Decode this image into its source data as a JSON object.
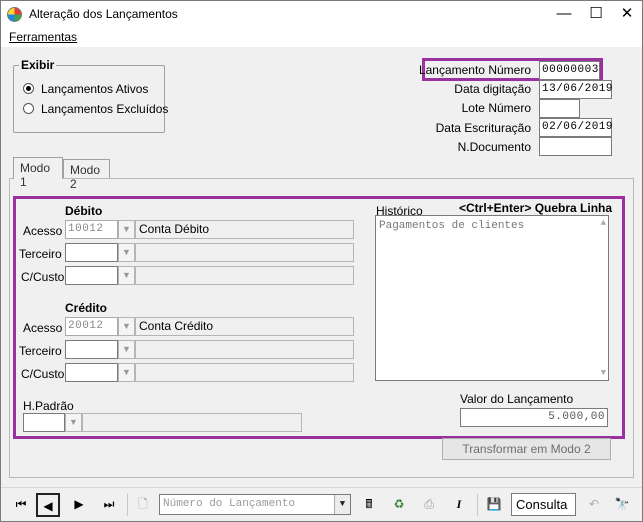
{
  "window": {
    "title": "Alteração dos Lançamentos",
    "minimize": "—",
    "maximize": "☐",
    "close": "✕"
  },
  "menu": {
    "ferramentas": "Ferramentas"
  },
  "exibir": {
    "title": "Exibir",
    "options": [
      {
        "label": "Lançamentos Ativos",
        "checked": true
      },
      {
        "label": "Lançamentos Excluídos",
        "checked": false
      }
    ]
  },
  "header": {
    "lancamento_numero_label": "Lançamento Número",
    "lancamento_numero_value": "00000003",
    "data_digitacao_label": "Data digitação",
    "data_digitacao_value": "13/06/2019",
    "lote_numero_label": "Lote Número",
    "lote_numero_value": "",
    "data_escrituracao_label": "Data Escrituração",
    "data_escrituracao_value": "02/06/2019",
    "n_documento_label": "N.Documento",
    "n_documento_value": ""
  },
  "tabs": [
    {
      "label": "Modo 1",
      "active": true
    },
    {
      "label": "Modo 2",
      "active": false
    }
  ],
  "debito": {
    "title": "Débito",
    "acesso_label": "Acesso",
    "acesso_value": "10012",
    "conta_label": "Conta Débito",
    "terceiro_label": "Terceiro",
    "ccusto_label": "C/Custo"
  },
  "credito": {
    "title": "Crédito",
    "acesso_label": "Acesso",
    "acesso_value": "20012",
    "conta_label": "Conta Crédito",
    "terceiro_label": "Terceiro",
    "ccusto_label": "C/Custo"
  },
  "historico": {
    "label": "Histórico",
    "hint": "<Ctrl+Enter> Quebra Linha",
    "value": "Pagamentos de clientes"
  },
  "hpadrao": {
    "label": "H.Padrão"
  },
  "valor": {
    "label": "Valor do Lançamento",
    "value": "5.000,00"
  },
  "transformar_button": "Transformar em Modo 2",
  "toolbar": {
    "search_placeholder": "Número do Lançamento",
    "status": "Consulta"
  },
  "colors": {
    "highlight": "#9b30a0"
  }
}
